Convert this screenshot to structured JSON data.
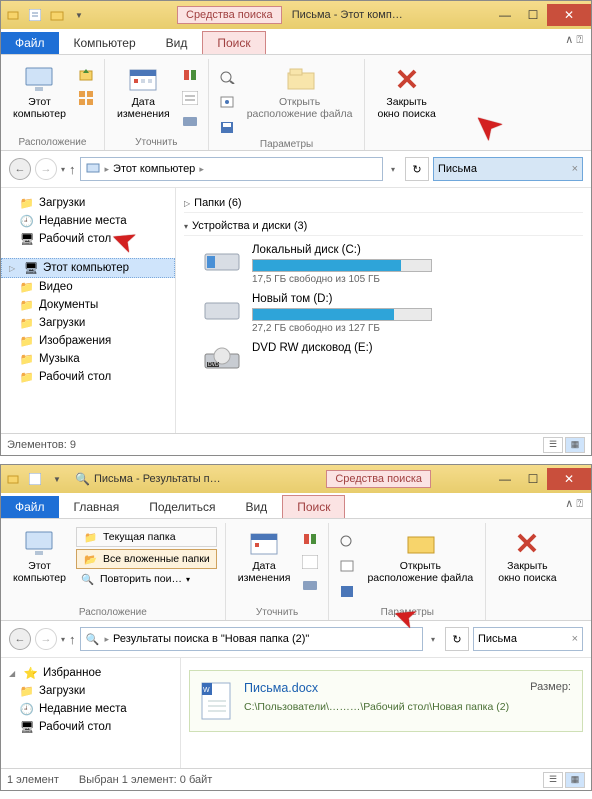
{
  "win1": {
    "toolsTab": "Средства поиска",
    "title": "Письма - Этот комп…",
    "tabs": {
      "file": "Файл",
      "computer": "Компьютер",
      "view": "Вид",
      "search": "Поиск"
    },
    "ribbon": {
      "thisPC": "Этот\nкомпьютер",
      "location": "Расположение",
      "dateChanged": "Дата\nизменения",
      "refine": "Уточнить",
      "openLocation": "Открыть\nрасположение файла",
      "params": "Параметры",
      "closeSearch": "Закрыть\nокно поиска"
    },
    "addr": {
      "root": "Этот компьютер"
    },
    "search": {
      "value": "Письма"
    },
    "sidebar": {
      "downloads": "Загрузки",
      "recent": "Недавние места",
      "desktop": "Рабочий стол",
      "thisPC": "Этот компьютер",
      "videos": "Видео",
      "documents": "Документы",
      "downloads2": "Загрузки",
      "pictures": "Изображения",
      "music": "Музыка",
      "desktop2": "Рабочий стол"
    },
    "content": {
      "folders": "Папки (6)",
      "devices": "Устройства и диски (3)",
      "driveC": {
        "name": "Локальный диск (C:)",
        "stat": "17,5 ГБ свободно из 105 ГБ",
        "fillPct": 83
      },
      "driveD": {
        "name": "Новый том (D:)",
        "stat": "27,2 ГБ свободно из 127 ГБ",
        "fillPct": 79
      },
      "dvd": {
        "name": "DVD RW дисковод (E:)"
      }
    },
    "status": "Элементов: 9"
  },
  "win2": {
    "toolsTab": "Средства поиска",
    "title": "Письма - Результаты п…",
    "tabs": {
      "file": "Файл",
      "home": "Главная",
      "share": "Поделиться",
      "view": "Вид",
      "search": "Поиск"
    },
    "ribbon": {
      "thisPC": "Этот\nкомпьютер",
      "currentFolder": "Текущая папка",
      "allSubfolders": "Все вложенные папки",
      "searchAgain": "Повторить пои…",
      "location": "Расположение",
      "dateChanged": "Дата\nизменения",
      "refine": "Уточнить",
      "openLocation": "Открыть\nрасположение файла",
      "params": "Параметры",
      "closeSearch": "Закрыть\nокно поиска"
    },
    "addr": {
      "text": "Результаты поиска в \"Новая папка (2)\""
    },
    "search": {
      "value": "Письма"
    },
    "sidebar": {
      "favorites": "Избранное",
      "downloads": "Загрузки",
      "recent": "Недавние места",
      "desktop": "Рабочий стол"
    },
    "result": {
      "name": "Письма.docx",
      "sizeLabel": "Размер:",
      "path": "C:\\Пользователи\\………\\Рабочий стол\\Новая папка (2)"
    },
    "status": {
      "count": "1 элемент",
      "size": "Выбран 1 элемент: 0 байт"
    }
  }
}
